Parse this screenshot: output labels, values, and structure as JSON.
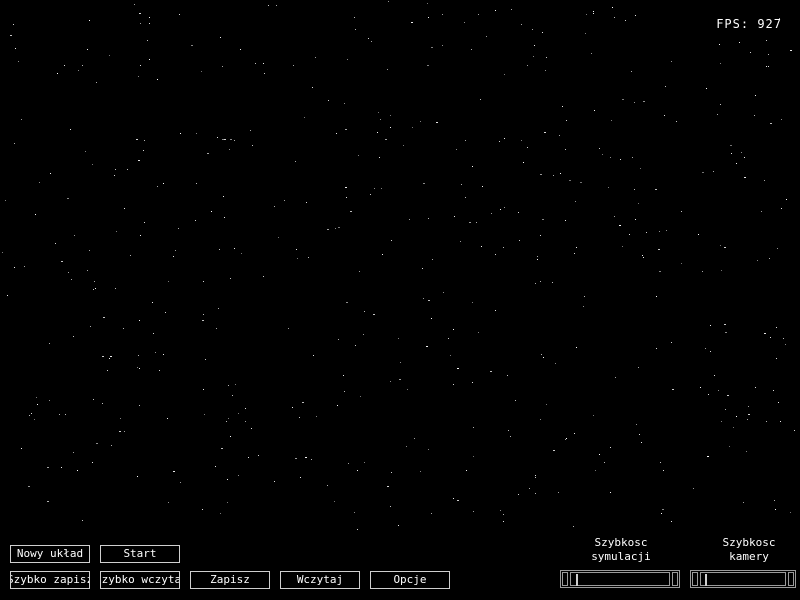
{
  "hud": {
    "fps_text": "FPS: 927"
  },
  "buttons": {
    "new_system": "Nowy układ",
    "start": "Start",
    "quick_save": "Szybko zapisz",
    "quick_load": "Szybko wczytaj",
    "save": "Zapisz",
    "load": "Wczytaj",
    "options": "Opcje"
  },
  "sliders": {
    "simulation_speed": {
      "label_line1": "Szybkosc",
      "label_line2": "symulacji",
      "value": 0.05
    },
    "camera_speed": {
      "label_line1": "Szybkosc",
      "label_line2": "kamery",
      "value": 0.05
    }
  },
  "colors": {
    "background": "#000000",
    "text": "#ffffff",
    "star": "#ffffff",
    "border": "#cfcfcf"
  }
}
